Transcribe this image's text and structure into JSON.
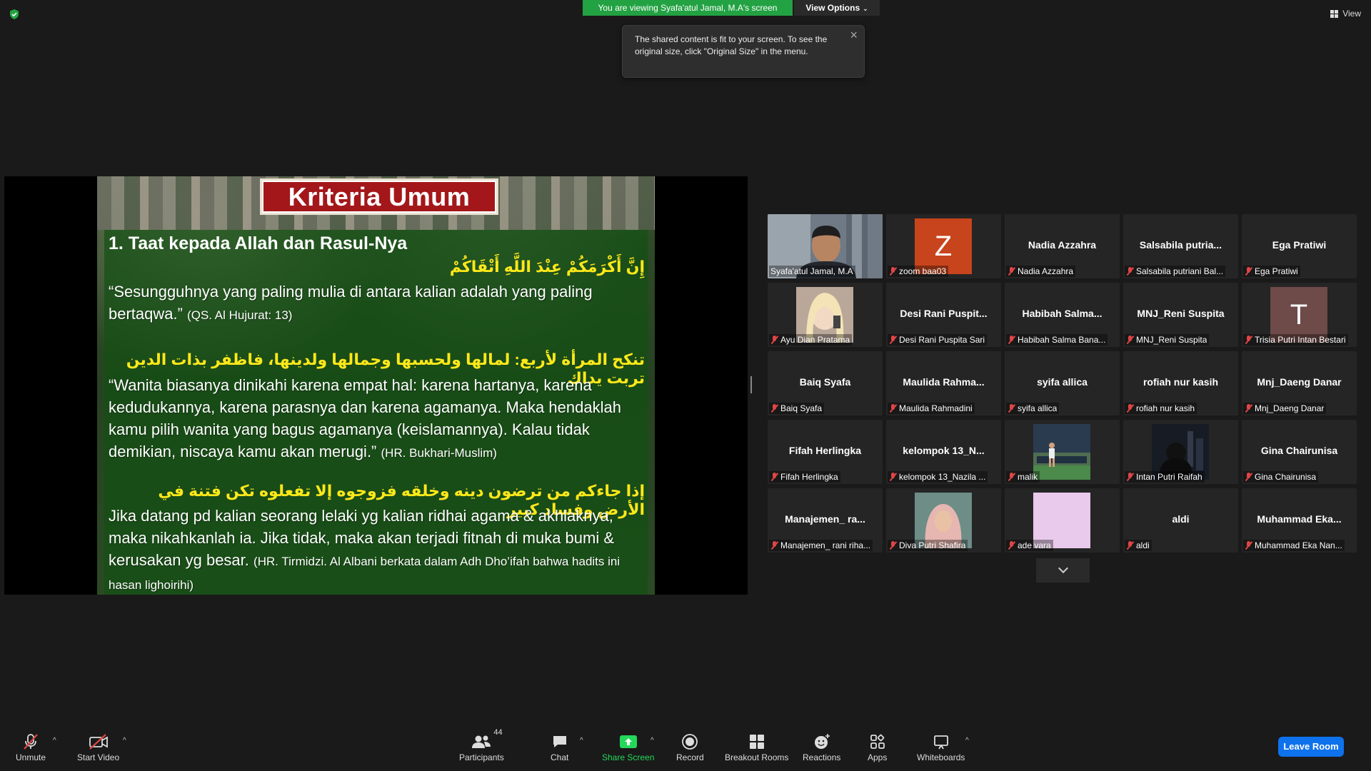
{
  "top": {
    "viewing_banner": "You are viewing Syafa'atul Jamal, M.A's screen",
    "view_options": "View Options",
    "view_label": "View",
    "tooltip_text": "The shared content is fit to your screen. To see the original size, click \"Original Size\" in the menu."
  },
  "slide": {
    "title": "Kriteria Umum",
    "heading": "1. Taat kepada Allah dan Rasul-Nya",
    "arabic1": "إِنَّ أَكْرَمَكُمْ عِنْدَ اللَّهِ أَتْقَاكُمْ",
    "text1": "“Sesungguhnya yang paling mulia di antara kalian adalah yang paling bertaqwa.”",
    "ref1": "(QS. Al Hujurat: 13)",
    "arabic2": "تنكح المرأة لأربع: لمالها ولحسبها وجمالها ولدينها، فاظفر بذات الدين تربت يداك",
    "text2": "“Wanita biasanya dinikahi karena empat hal: karena hartanya, karena kedudukannya, karena parasnya dan karena agamanya. Maka hendaklah kamu pilih wanita yang bagus agamanya (keislamannya). Kalau tidak demikian, niscaya kamu akan merugi.”",
    "ref2": "(HR. Bukhari-Muslim)",
    "arabic3": "إذا جاءكم من ترضون دينه وخلقه فزوجوه إلا تفعلوه تكن فتنة في الأرض وفساد كبير",
    "text3": "Jika datang pd kalian seorang lelaki yg kalian ridhai agama & akhlaknya, maka nikahkanlah ia. Jika tidak, maka akan terjadi fitnah di muka bumi & kerusakan yg besar.",
    "ref3": "(HR. Tirmidzi. Al Albani berkata dalam Adh Dho’ifah bahwa hadits ini hasan lighoirihi)"
  },
  "participants": [
    {
      "name": "",
      "label": "Syafa'atul Jamal, M.A",
      "muted": false,
      "kind": "video",
      "active": true
    },
    {
      "name": "",
      "label": "zoom baa03",
      "muted": true,
      "kind": "letter",
      "letter": "Z",
      "color": "#c8441c"
    },
    {
      "name": "Nadia Azzahra",
      "label": "Nadia Azzahra",
      "muted": true,
      "kind": "name"
    },
    {
      "name": "Salsabila  putria...",
      "label": "Salsabila putriani Bal...",
      "muted": true,
      "kind": "name"
    },
    {
      "name": "Ega Pratiwi",
      "label": "Ega Pratiwi",
      "muted": true,
      "kind": "name"
    },
    {
      "name": "",
      "label": "Ayu Dian Pratama",
      "muted": true,
      "kind": "photo",
      "photo": "blonde"
    },
    {
      "name": "Desi Rani Puspit...",
      "label": "Desi Rani Puspita Sari",
      "muted": true,
      "kind": "name"
    },
    {
      "name": "Habibah  Salma...",
      "label": "Habibah Salma Bana...",
      "muted": true,
      "kind": "name"
    },
    {
      "name": "MNJ_Reni Suspita",
      "label": "MNJ_Reni Suspita",
      "muted": true,
      "kind": "name"
    },
    {
      "name": "",
      "label": "Trisia Putri Intan Bestari",
      "muted": true,
      "kind": "letter",
      "letter": "T",
      "color": "#6e4a48"
    },
    {
      "name": "Baiq Syafa",
      "label": "Baiq Syafa",
      "muted": true,
      "kind": "name"
    },
    {
      "name": "Maulida  Rahma...",
      "label": "Maulida Rahmadini",
      "muted": true,
      "kind": "name"
    },
    {
      "name": "syifa allica",
      "label": "syifa allica",
      "muted": true,
      "kind": "name"
    },
    {
      "name": "rofiah nur kasih",
      "label": "rofiah nur kasih",
      "muted": true,
      "kind": "name"
    },
    {
      "name": "Mnj_Daeng Danar",
      "label": "Mnj_Daeng Danar",
      "muted": true,
      "kind": "name"
    },
    {
      "name": "Fifah Herlingka",
      "label": "Fifah Herlingka",
      "muted": true,
      "kind": "name"
    },
    {
      "name": "kelompok 13_N...",
      "label": "kelompok 13_Nazila ...",
      "muted": true,
      "kind": "name"
    },
    {
      "name": "",
      "label": "malik",
      "muted": true,
      "kind": "photo",
      "photo": "field"
    },
    {
      "name": "",
      "label": "Intan Putri Raifah",
      "muted": true,
      "kind": "photo",
      "photo": "night"
    },
    {
      "name": "Gina Chairunisa",
      "label": "Gina Chairunisa",
      "muted": true,
      "kind": "name"
    },
    {
      "name": "Manajemen_  ra...",
      "label": "Manajemen_ rani riha...",
      "muted": true,
      "kind": "name"
    },
    {
      "name": "",
      "label": "Diva Putri Shafira",
      "muted": true,
      "kind": "photo",
      "photo": "hijab"
    },
    {
      "name": "",
      "label": "ade vara",
      "muted": true,
      "kind": "photo",
      "photo": "pink"
    },
    {
      "name": "aldi",
      "label": "aldi",
      "muted": true,
      "kind": "name"
    },
    {
      "name": "Muhammad  Eka...",
      "label": "Muhammad Eka Nan...",
      "muted": true,
      "kind": "name"
    }
  ],
  "toolbar": {
    "unmute": "Unmute",
    "start_video": "Start Video",
    "participants": "Participants",
    "participants_count": "44",
    "chat": "Chat",
    "share_screen": "Share Screen",
    "record": "Record",
    "breakout_rooms": "Breakout Rooms",
    "reactions": "Reactions",
    "apps": "Apps",
    "whiteboards": "Whiteboards",
    "leave": "Leave Room"
  },
  "colors": {
    "banner_green": "#23a243",
    "active_speaker": "#c9e84a",
    "share_green": "#23d959",
    "leave_blue": "#0e72ed",
    "muted_red": "#e04545"
  }
}
